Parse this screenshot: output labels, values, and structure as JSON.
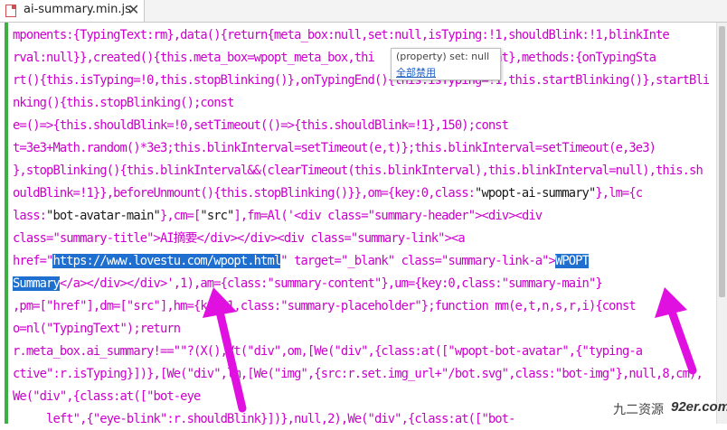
{
  "tab": {
    "label": "ai-summary.min.js",
    "close": "✕"
  },
  "tooltip": {
    "signature": "(property) set: null",
    "action": "全部禁用"
  },
  "watermark": {
    "cn": "九二资源",
    "site": "92er.com"
  },
  "colors": {
    "code": "#cc00cc",
    "selection": "#1e6fd0",
    "arrow": "#e010e0",
    "gutter": "#3cb043"
  },
  "code": {
    "l0": "mponents:{TypingText:rm},data(){return{meta_box:null,set:null,isTyping:!1,shouldBlink:!1,blinkInte",
    "l1a": "rval:null}},created(){this.meta_box=wpopt_meta_box,thi",
    "l1b": "                 ont},methods:{onTypingSta",
    "l2": "rt(){this.isTyping=!0,this.stopBlinking()},onTypingEnd(){this.isTyping=!1,this.startBlinking()},startBli",
    "l3": "nking(){this.stopBlinking();const",
    "l4": "e=()=>{this.shouldBlink=!0,setTimeout(()=>{this.shouldBlink=!1},150);const",
    "l5": "t=3e3+Math.random()*3e3;this.blinkInterval=setTimeout(e,t)};this.blinkInterval=setTimeout(e,3e3)",
    "l6": "},stopBlinking(){this.blinkInterval&&(clearTimeout(this.blinkInterval),this.blinkInterval=null),this.sh",
    "l7a": "ouldBlink=!1}},beforeUnmount(){this.stopBlinking()}},om={key:0,class:",
    "l7b": "\"wpopt-ai-summary\"",
    "l7c": "},lm={c",
    "l8a": "lass:",
    "l8b": "\"bot-avatar-main\"",
    "l8c": "},cm=[",
    "l8d": "\"src\"",
    "l8e": "],fm=Al('",
    "l8f": "<div class=\"summary-header\"><div><div",
    "l9a": "class=\"summary-title\">AI摘要</div></div><div class=\"summary-link\"><a",
    "l10a": "href=\"",
    "l10sel": "https://www.lovestu.com/wpopt.html",
    "l10b": "\" target=\"_blank\" class=\"summary-link-a\">",
    "l10sel2": "WPOPT",
    "l11sel": "Summary",
    "l11b": "</a></div></div>',1),am={class:\"summary-content\"},um={key:0,class:\"summary-main\"}",
    "l12": ",pm=[\"href\"],dm=[\"src\"],hm={key:1,class:\"summary-placeholder\"};function mm(e,t,n,s,r,i){const",
    "l13": "o=nl(\"TypingText\");return",
    "l14": "r.meta_box.ai_summary!==\"\"?(X(),Vt(\"div\",om,[We(\"div\",{class:at([\"wpopt-bot-avatar\",{\"typing-a",
    "l15": "ctive\":r.isTyping}])},[We(\"div\",lm,[We(\"img\",{src:r.set.img_url+\"/bot.svg\",class:\"bot-img\"},null,8,cm),",
    "l16": "We(\"div\",{class:at([\"bot-eye",
    "l17": "     left\",{\"eye-blink\":r.shouldBlink}])},null,2),We(\"div\",{class:at([\"bot-"
  }
}
